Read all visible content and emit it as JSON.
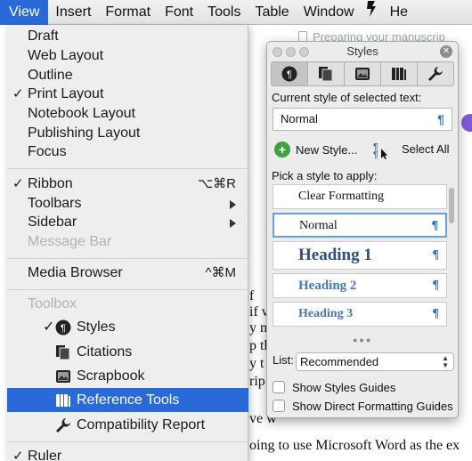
{
  "menubar": {
    "items": [
      "View",
      "Insert",
      "Format",
      "Font",
      "Tools",
      "Table",
      "Window"
    ],
    "help": "He",
    "script_icon": "script-menu-icon"
  },
  "view_menu": {
    "draft": "Draft",
    "web_layout": "Web Layout",
    "outline": "Outline",
    "print_layout": "Print Layout",
    "notebook_layout": "Notebook Layout",
    "publishing_layout": "Publishing Layout",
    "focus": "Focus",
    "ribbon": "Ribbon",
    "ribbon_shortcut": "⌥⌘R",
    "toolbars": "Toolbars",
    "sidebar": "Sidebar",
    "message_bar": "Message Bar",
    "media_browser": "Media Browser",
    "media_browser_shortcut": "^⌘M",
    "toolbox_header": "Toolbox",
    "styles": "Styles",
    "citations": "Citations",
    "scrapbook": "Scrapbook",
    "reference_tools": "Reference Tools",
    "compatibility_report": "Compatibility Report",
    "ruler": "Ruler",
    "check": "✓"
  },
  "document": {
    "title": "Preparing your manuscrip",
    "lines": [
      "f",
      "if v",
      "y m",
      "p th",
      "y t",
      "rip",
      "",
      "ve w",
      "",
      "oing to use Microsoft Word as the ex"
    ]
  },
  "styles_panel": {
    "title": "Styles",
    "tabs": [
      "styles-tab-icon",
      "citations-tab-icon",
      "scrapbook-tab-icon",
      "reference-tools-tab-icon",
      "compatibility-tab-icon"
    ],
    "current_style_label": "Current style of selected text:",
    "current_style": "Normal",
    "new_style": "New Style...",
    "select_all": "Select All",
    "pick_label": "Pick a style to apply:",
    "styles": [
      "Clear Formatting",
      "Normal",
      "Heading 1",
      "Heading 2",
      "Heading 3"
    ],
    "pilcrow": "¶",
    "list_label": "List:",
    "list_value": "Recommended",
    "show_styles_guides": "Show Styles Guides",
    "show_direct_formatting_guides": "Show Direct Formatting Guides"
  },
  "colors": {
    "menu_highlight": "#2a6ad8",
    "pilcrow_blue": "#2c74c7",
    "heading_blue": "#4a76b8"
  }
}
